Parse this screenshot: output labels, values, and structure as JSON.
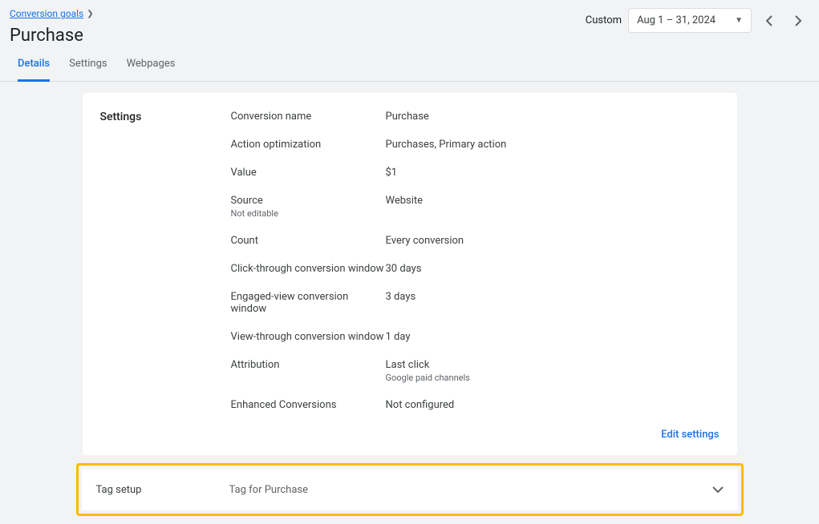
{
  "breadcrumb": {
    "parent": "Conversion goals"
  },
  "page_title": "Purchase",
  "date": {
    "label": "Custom",
    "range": "Aug 1 – 31, 2024"
  },
  "tabs": {
    "details": "Details",
    "settings": "Settings",
    "webpages": "Webpages"
  },
  "settings": {
    "heading": "Settings",
    "conversion_name": {
      "label": "Conversion name",
      "value": "Purchase"
    },
    "action_optimization": {
      "label": "Action optimization",
      "value": "Purchases, Primary action"
    },
    "value": {
      "label": "Value",
      "value": "$1"
    },
    "source": {
      "label": "Source",
      "sub": "Not editable",
      "value": "Website"
    },
    "count": {
      "label": "Count",
      "value": "Every conversion"
    },
    "click_through": {
      "label": "Click-through conversion window",
      "value": "30 days"
    },
    "engaged_view": {
      "label": "Engaged-view conversion window",
      "value": "3 days"
    },
    "view_through": {
      "label": "View-through conversion window",
      "value": "1 day"
    },
    "attribution": {
      "label": "Attribution",
      "value": "Last click",
      "value_sub": "Google paid channels"
    },
    "enhanced": {
      "label": "Enhanced Conversions",
      "value": "Not configured"
    },
    "edit": "Edit settings"
  },
  "tag_setup": {
    "label": "Tag setup",
    "value": "Tag for Purchase"
  }
}
